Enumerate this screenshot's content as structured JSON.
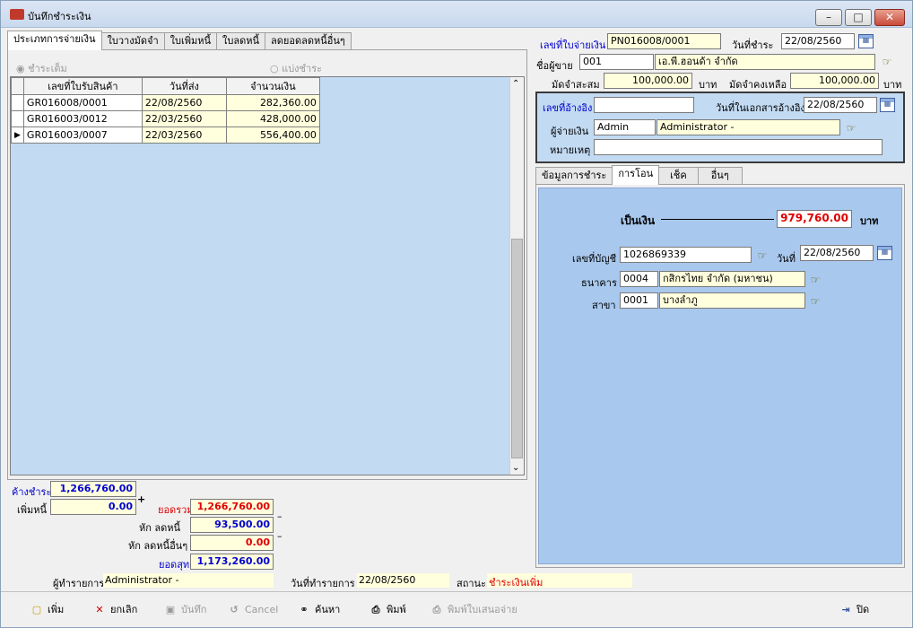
{
  "window": {
    "title": "บันทึกชำระเงิน",
    "min": "–",
    "max": "□",
    "close": "✕"
  },
  "left_tabs": [
    "ประเภทการจ่ายเงิน",
    "ใบวางมัดจำ",
    "ใบเพิ่มหนี้",
    "ใบลดหนี้",
    "ลดยอดลดหนี้อื่นๆ"
  ],
  "radios": {
    "full": "ชำระเต็ม",
    "partial": "แบ่งชำระ"
  },
  "grid": {
    "headers": [
      "เลขที่ใบรับสินค้า",
      "วันที่ส่ง",
      "จำนวนเงิน"
    ],
    "rows": [
      {
        "doc": "GR016008/0001",
        "date": "22/08/2560",
        "amount": "282,360.00"
      },
      {
        "doc": "GR016003/0012",
        "date": "22/03/2560",
        "amount": "428,000.00"
      },
      {
        "doc": "GR016003/0007",
        "date": "22/03/2560",
        "amount": "556,400.00"
      }
    ],
    "current_row_marker": "▶"
  },
  "summary": {
    "outstanding_label": "ค้างชำระ",
    "outstanding": "1,266,760.00",
    "debit_label": "เพิ่มหนี้",
    "debit": "0.00",
    "plus": "+",
    "total_label": "ยอดรวม",
    "total": "1,266,760.00",
    "credit_label": "หัก ลดหนี้",
    "credit": "93,500.00",
    "other_label": "หัก ลดหนี้อื่นๆ",
    "other": "0.00",
    "net_label": "ยอดสุทธิ",
    "net": "1,173,260.00",
    "minus1": "–",
    "minus2": "–"
  },
  "footer_info": {
    "operator_label": "ผู้ทำรายการ",
    "operator": "Administrator -",
    "date_label": "วันที่ทำรายการ",
    "date": "22/08/2560",
    "status_label": "สถานะ",
    "status": "ชำระเงินเพิ่ม"
  },
  "header": {
    "pay_no_label": "เลขที่ใบจ่ายเงิน",
    "pay_no": "PN016008/0001",
    "pay_date_label": "วันที่ชำระ",
    "pay_date": "22/08/2560",
    "vendor_label": "ชื่อผู้ขาย",
    "vendor_code": "001",
    "vendor_name": "เอ.พี.ฮอนด้า จำกัด",
    "deposit_label": "มัดจำสะสม",
    "deposit": "100,000.00",
    "baht1": "บาท",
    "deposit_left_label": "มัดจำคงเหลือ",
    "deposit_left": "100,000.00",
    "baht2": "บาท"
  },
  "ref": {
    "ref_no_label": "เลขที่อ้างอิง",
    "ref_no": "",
    "ref_date_label": "วันที่ในเอกสารอ้างอิง",
    "ref_date": "22/08/2560",
    "payer_label": "ผู้จ่ายเงิน",
    "payer_code": "Admin",
    "payer_name": "Administrator -",
    "note_label": "หมายเหตุ",
    "note": ""
  },
  "right_tabs": [
    "ข้อมูลการชำระ",
    "การโอน",
    "เช็ค",
    "อื่นๆ"
  ],
  "transfer": {
    "amount_label": "เป็นเงิน",
    "amount": "979,760.00",
    "baht": "บาท",
    "account_label": "เลขที่บัญชี",
    "account": "1026869339",
    "date_label": "วันที่",
    "date": "22/08/2560",
    "bank_label": "ธนาคาร",
    "bank_code": "0004",
    "bank_name": "กสิกรไทย จำกัด (มหาชน)",
    "branch_label": "สาขา",
    "branch_code": "0001",
    "branch_name": "บางลำภู"
  },
  "toolbar": {
    "add": "เพิ่ม",
    "cancel_doc": "ยกเลิก",
    "save": "บันทึก",
    "cancel": "Cancel",
    "search": "ค้นหา",
    "print": "พิมพ์",
    "print_proposal": "พิมพ์ใบเสนอจ่าย",
    "close": "ปิด"
  },
  "colors": {
    "grid_bg": "#c2daf2",
    "panel_bg": "#a8c8ee",
    "highlight_red": "#e00000",
    "value_blue": "#0000d0"
  }
}
